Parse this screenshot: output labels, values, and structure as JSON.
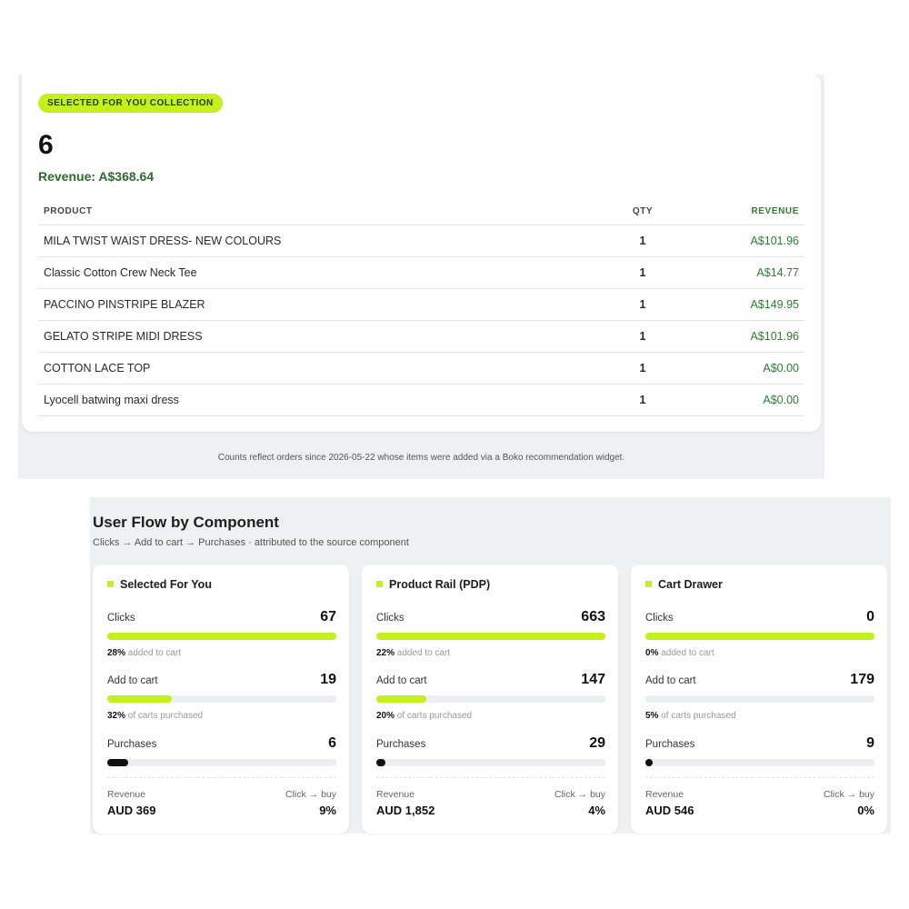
{
  "collection": {
    "badge": "SELECTED FOR YOU COLLECTION",
    "count": "6",
    "revenue": "Revenue: A$368.64",
    "columns": {
      "product": "PRODUCT",
      "qty": "QTY",
      "revenue": "REVENUE"
    },
    "rows": [
      {
        "product": "MILA TWIST WAIST DRESS- NEW COLOURS",
        "qty": "1",
        "revenue": "A$101.96"
      },
      {
        "product": "Classic Cotton Crew Neck Tee",
        "qty": "1",
        "revenue": "A$14.77"
      },
      {
        "product": "PACCINO PINSTRIPE BLAZER",
        "qty": "1",
        "revenue": "A$149.95"
      },
      {
        "product": "GELATO STRIPE MIDI DRESS",
        "qty": "1",
        "revenue": "A$101.96"
      },
      {
        "product": "COTTON LACE TOP",
        "qty": "1",
        "revenue": "A$0.00"
      },
      {
        "product": "Lyocell batwing maxi dress",
        "qty": "1",
        "revenue": "A$0.00"
      }
    ],
    "footnote": "Counts reflect orders since 2026-05-22 whose items were added via a Boko recommendation widget."
  },
  "flow": {
    "title": "User Flow by Component",
    "subtitle": "Clicks → Add to cart → Purchases · attributed to the source component",
    "labels": {
      "clicks": "Clicks",
      "add_to_cart": "Add to cart",
      "purchases": "Purchases",
      "added_to_cart": "added to cart",
      "carts_purchased": "of carts purchased",
      "revenue": "Revenue",
      "click_to_buy": "Click → buy"
    },
    "components": [
      {
        "name": "Selected For You",
        "clicks": "67",
        "add_to_cart": "19",
        "purchases": "6",
        "added_pct": "28%",
        "purchased_pct": "32%",
        "clicks_fill": 1.0,
        "cart_fill": 0.28,
        "purchase_fill": 0.09,
        "revenue": "AUD 369",
        "click_to_buy": "9%"
      },
      {
        "name": "Product Rail (PDP)",
        "clicks": "663",
        "add_to_cart": "147",
        "purchases": "29",
        "added_pct": "22%",
        "purchased_pct": "20%",
        "clicks_fill": 1.0,
        "cart_fill": 0.22,
        "purchase_fill": 0.04,
        "revenue": "AUD 1,852",
        "click_to_buy": "4%"
      },
      {
        "name": "Cart Drawer",
        "clicks": "0",
        "add_to_cart": "179",
        "purchases": "9",
        "added_pct": "0%",
        "purchased_pct": "5%",
        "clicks_fill": 1.0,
        "cart_fill": 0.0,
        "purchase_fill": 0.0,
        "revenue": "AUD 546",
        "click_to_buy": "0%"
      }
    ]
  },
  "colors": {
    "accent": "#c6f01b",
    "revenue_green": "#2e7d32",
    "dark": "#111111"
  }
}
